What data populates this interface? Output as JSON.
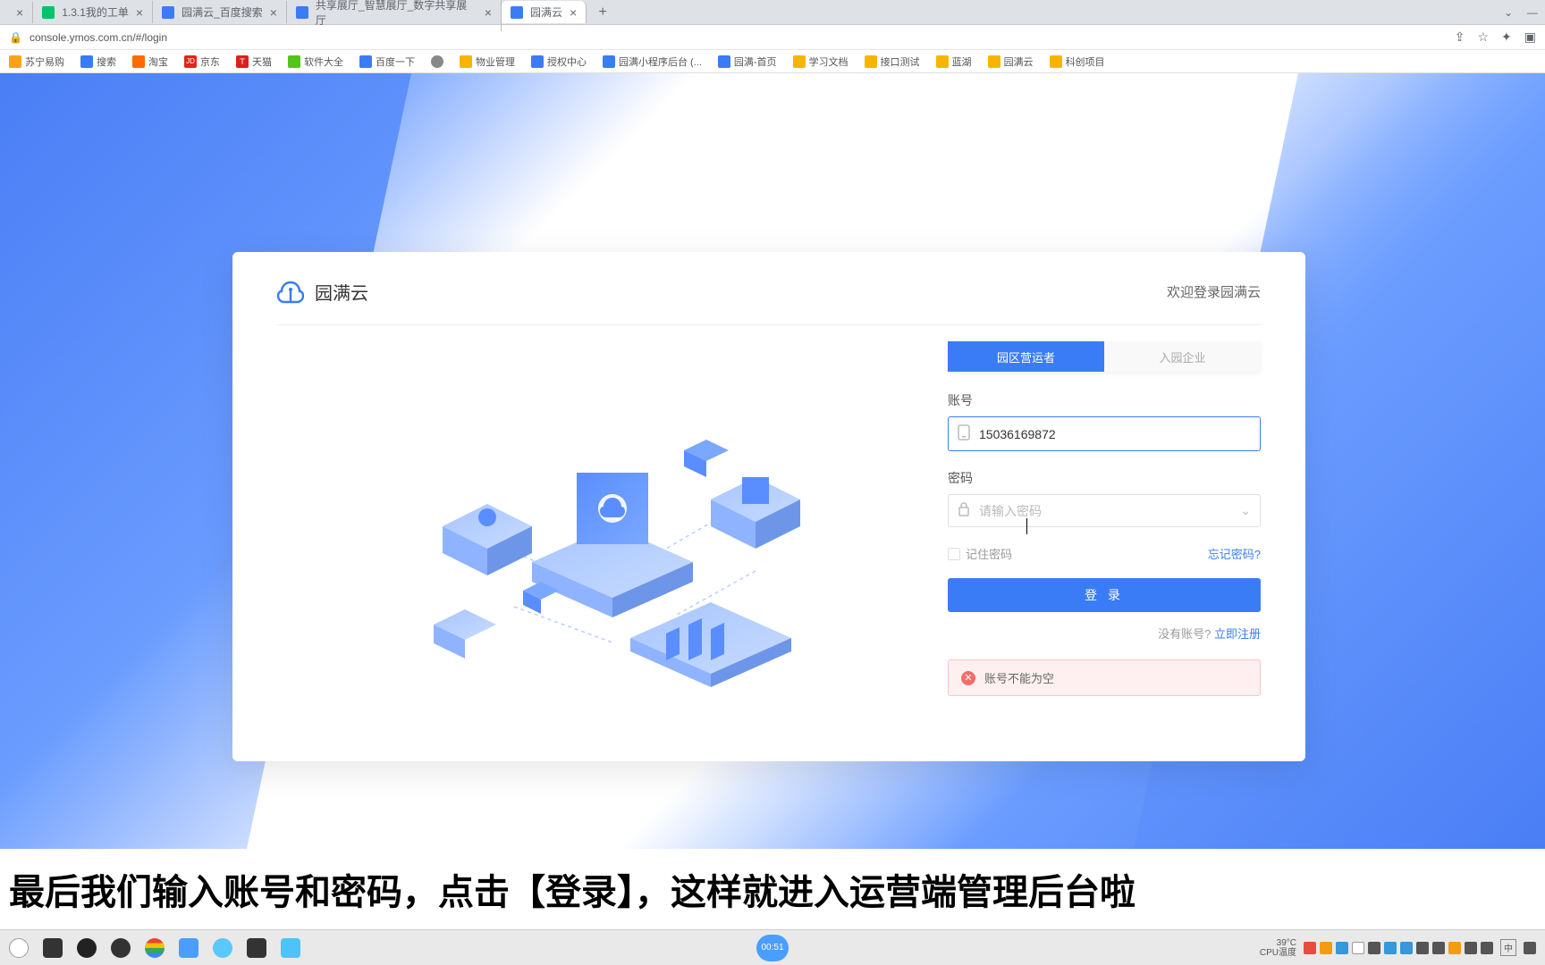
{
  "browser": {
    "tabs": [
      {
        "title": "",
        "active": false
      },
      {
        "title": "1.3.1我的工单",
        "active": false
      },
      {
        "title": "园满云_百度搜索",
        "active": false
      },
      {
        "title": "共享展厅_智慧展厅_数字共享展厅",
        "active": false
      },
      {
        "title": "园满云",
        "active": true
      }
    ],
    "url": "console.ymos.com.cn/#/login"
  },
  "bookmarks": [
    {
      "label": "苏宁易购",
      "color": "#fca311"
    },
    {
      "label": "搜索",
      "color": "#3a7cf5"
    },
    {
      "label": "淘宝",
      "color": "#ff6a00"
    },
    {
      "label": "京东",
      "color": "#e1251b"
    },
    {
      "label": "天猫",
      "color": "#d9201e"
    },
    {
      "label": "软件大全",
      "color": "#52c41a"
    },
    {
      "label": "百度一下",
      "color": "#3a7cf5"
    },
    {
      "label": "",
      "color": "#888"
    },
    {
      "label": "物业管理",
      "color": "#f7b500"
    },
    {
      "label": "授权中心",
      "color": "#3a7cf5"
    },
    {
      "label": "园满小程序后台 (...",
      "color": "#3a7cf5"
    },
    {
      "label": "园满-首页",
      "color": "#3a7cf5"
    },
    {
      "label": "学习文档",
      "color": "#f7b500"
    },
    {
      "label": "接口测试",
      "color": "#f7b500"
    },
    {
      "label": "蓝湖",
      "color": "#f7b500"
    },
    {
      "label": "园满云",
      "color": "#f7b500"
    },
    {
      "label": "科创项目",
      "color": "#f7b500"
    }
  ],
  "login": {
    "brand_name": "园满云",
    "welcome": "欢迎登录园满云",
    "tab_operator": "园区营运者",
    "tab_enterprise": "入园企业",
    "account_label": "账号",
    "account_value": "15036169872",
    "password_label": "密码",
    "password_placeholder": "请输入密码",
    "remember_label": "记住密码",
    "forgot_label": "忘记密码?",
    "login_button": "登 录",
    "no_account": "没有账号?",
    "signup_link": "立即注册",
    "error_msg": "账号不能为空"
  },
  "subtitle": "最后我们输入账号和密码，点击【登录】，这样就进入运营端管理后台啦",
  "taskbar": {
    "temp": "39°C",
    "temp_label": "CPU温度",
    "clock": "00:51",
    "lang": "中"
  }
}
